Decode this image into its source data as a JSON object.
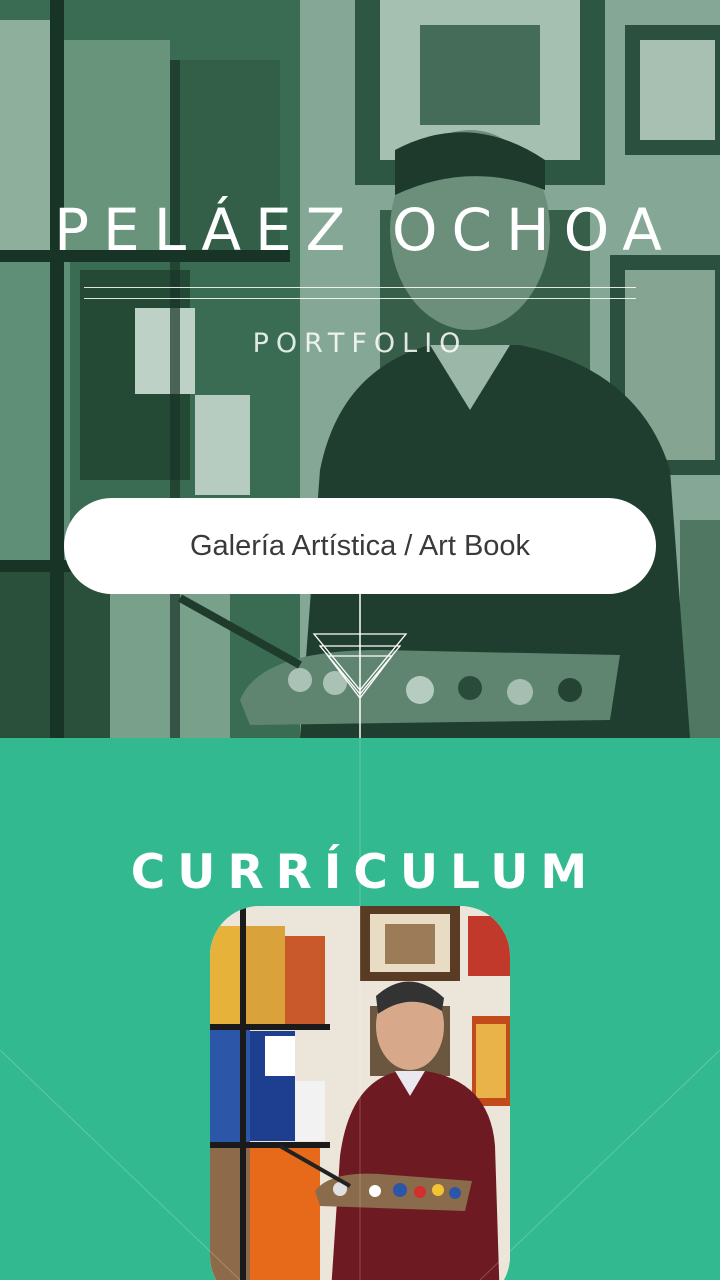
{
  "hero": {
    "title": "PELÁEZ OCHOA",
    "subtitle": "PORTFOLIO",
    "gallery_button": "Galería Artística / Art Book"
  },
  "curriculum": {
    "title": "CURRÍCULUM"
  },
  "colors": {
    "accent_green": "#33b98f",
    "hero_tint": "#3d6a52",
    "button_bg": "#ffffff",
    "button_text": "#3a3a3a"
  },
  "icons": {
    "hero_divider": "nested-triangles-down-icon"
  }
}
